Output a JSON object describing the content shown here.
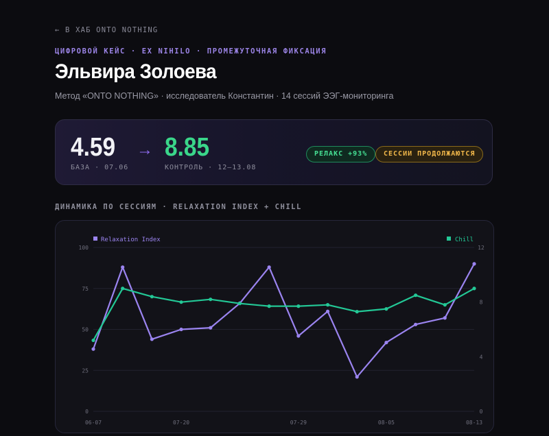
{
  "nav": {
    "back": "← В ХАБ ONTO NOTHING"
  },
  "header": {
    "eyebrow": "ЦИФРОВОЙ КЕЙС · EX NIHILO · ПРОМЕЖУТОЧНАЯ ФИКСАЦИЯ",
    "title": "Эльвира Золоева",
    "subtitle": "Метод «ONTO NOTHING» · исследователь Константин · 14 сессий ЭЭГ-мониторинга"
  },
  "summary": {
    "base_value": "4.59",
    "base_label": "БАЗА · 07.06",
    "arrow": "→",
    "control_value": "8.85",
    "control_label": "КОНТРОЛЬ · 12–13.08",
    "badge_relax": "РЕЛАКС +93%",
    "badge_status": "СЕССИИ ПРОДОЛЖАЮТСЯ"
  },
  "section_title": "ДИНАМИКА ПО СЕССИЯМ · RELAXATION INDEX + CHILL",
  "colors": {
    "relax": "#9b84f0",
    "chill": "#23c896",
    "grid": "#23232f",
    "tick": "#6e6e7c"
  },
  "chart_data": {
    "type": "line",
    "legend": {
      "left": "Relaxation Index",
      "right": "Chill"
    },
    "x_ticks": [
      "06-07",
      "07-20",
      "07-29",
      "08-05",
      "08-13"
    ],
    "x_tick_index": [
      0,
      3,
      7,
      10,
      13
    ],
    "y_left": {
      "ticks": [
        "100",
        "75",
        "50",
        "25",
        "0"
      ],
      "range": [
        0,
        100
      ]
    },
    "y_right": {
      "ticks": [
        "12",
        "8",
        "4",
        "0"
      ],
      "range": [
        0,
        12
      ]
    },
    "series": [
      {
        "name": "Relaxation Index",
        "axis": "left",
        "values": [
          38,
          88,
          44,
          50,
          51,
          66,
          88,
          46,
          61,
          21,
          42,
          53,
          57,
          90
        ]
      },
      {
        "name": "Chill",
        "axis": "right",
        "values": [
          5.2,
          9.0,
          8.4,
          8.0,
          8.2,
          7.9,
          7.7,
          7.7,
          7.8,
          7.3,
          7.5,
          8.5,
          7.8,
          9.0
        ]
      }
    ]
  }
}
